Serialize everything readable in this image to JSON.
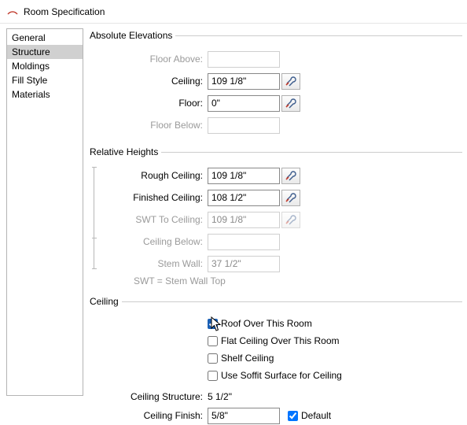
{
  "window": {
    "title": "Room Specification"
  },
  "sidebar": {
    "selected_index": 1,
    "items": [
      {
        "label": "General"
      },
      {
        "label": "Structure"
      },
      {
        "label": "Moldings"
      },
      {
        "label": "Fill Style"
      },
      {
        "label": "Materials"
      }
    ]
  },
  "absolute_elevations": {
    "legend": "Absolute Elevations",
    "floor_above": {
      "label": "Floor Above:",
      "value": "",
      "enabled": false,
      "wrench": false
    },
    "ceiling": {
      "label": "Ceiling:",
      "value": "109 1/8\"",
      "enabled": true,
      "wrench": true
    },
    "floor": {
      "label": "Floor:",
      "value": "0\"",
      "enabled": true,
      "wrench": true
    },
    "floor_below": {
      "label": "Floor Below:",
      "value": "",
      "enabled": false,
      "wrench": false
    }
  },
  "relative_heights": {
    "legend": "Relative Heights",
    "rough_ceiling": {
      "label": "Rough Ceiling:",
      "value": "109 1/8\"",
      "enabled": true,
      "wrench": true
    },
    "finished_ceiling": {
      "label": "Finished Ceiling:",
      "value": "108 1/2\"",
      "enabled": true,
      "wrench": true
    },
    "swt_to_ceiling": {
      "label": "SWT To Ceiling:",
      "value": "109 1/8\"",
      "enabled": false,
      "wrench": true
    },
    "ceiling_below": {
      "label": "Ceiling Below:",
      "value": "",
      "enabled": false,
      "wrench": false
    },
    "stem_wall": {
      "label": "Stem Wall:",
      "value": "37 1/2\"",
      "enabled": false,
      "wrench": false
    },
    "hint": "SWT = Stem Wall Top"
  },
  "ceiling": {
    "legend": "Ceiling",
    "roof_over": {
      "label": "Roof Over This Room",
      "checked": true
    },
    "flat_ceiling": {
      "label": "Flat Ceiling Over This Room",
      "checked": false
    },
    "shelf": {
      "label": "Shelf Ceiling",
      "checked": false
    },
    "soffit": {
      "label": "Use Soffit Surface for Ceiling",
      "checked": false
    },
    "structure": {
      "label": "Ceiling Structure:",
      "value": "5 1/2\""
    },
    "finish": {
      "label": "Ceiling Finish:",
      "value": "5/8\"",
      "default_label": "Default",
      "default_checked": true
    }
  }
}
